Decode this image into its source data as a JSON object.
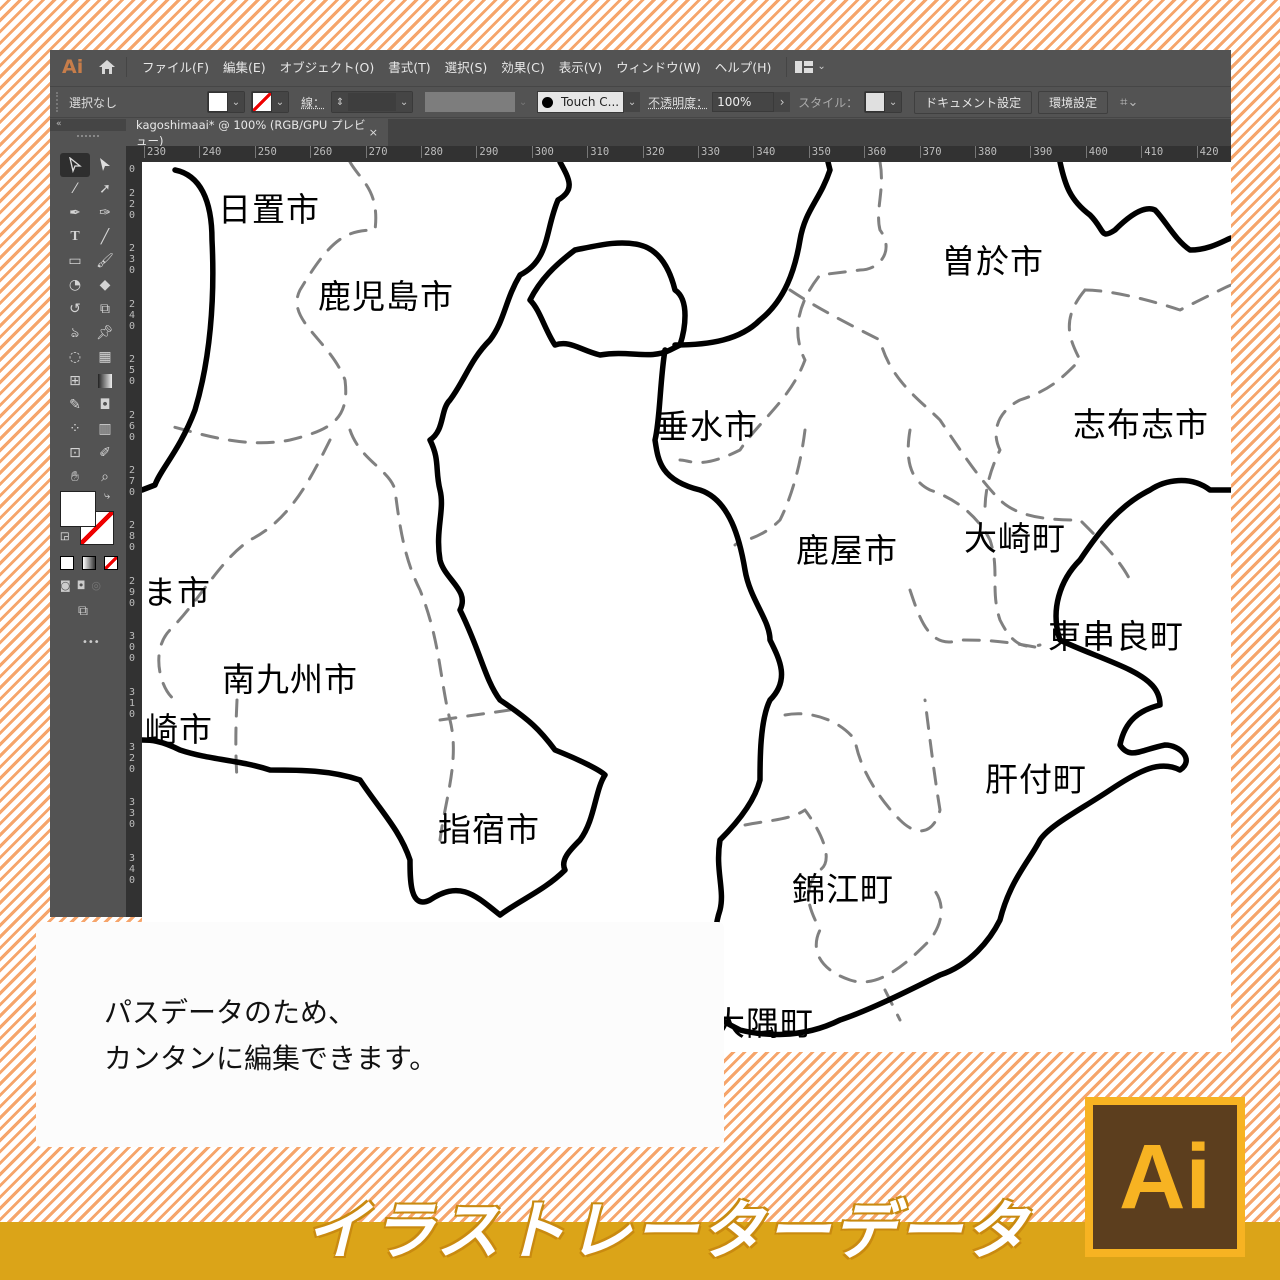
{
  "app": {
    "logo": "Ai",
    "menu": [
      "ファイル(F)",
      "編集(E)",
      "オブジェクト(O)",
      "書式(T)",
      "選択(S)",
      "効果(C)",
      "表示(V)",
      "ウィンドウ(W)",
      "ヘルプ(H)"
    ]
  },
  "control_bar": {
    "selection_status": "選択なし",
    "stroke_label": "線：",
    "brush_name": "Touch C...",
    "opacity_label": "不透明度：",
    "opacity_value": "100%",
    "style_label": "スタイル：",
    "document_setup_button": "ドキュメント設定",
    "preferences_button": "環境設定"
  },
  "document_tab": {
    "title": "kagoshimaai* @ 100% (RGB/GPU プレビュー)",
    "close": "×"
  },
  "rulers": {
    "horizontal": [
      "230",
      "240",
      "250",
      "260",
      "270",
      "280",
      "290",
      "300",
      "310",
      "320",
      "330",
      "340",
      "350",
      "360",
      "370",
      "380",
      "390",
      "400",
      "410",
      "420"
    ],
    "vertical": [
      "0",
      "220",
      "230",
      "240",
      "250",
      "260",
      "270",
      "280",
      "290",
      "300",
      "310",
      "320",
      "330",
      "340"
    ]
  },
  "map": {
    "places": [
      {
        "name": "日置市"
      },
      {
        "name": "鹿児島市"
      },
      {
        "name": "垂水市"
      },
      {
        "name": "曽於市"
      },
      {
        "name": "志布志市"
      },
      {
        "name": "大崎町"
      },
      {
        "name": "鹿屋市"
      },
      {
        "name": "東串良町"
      },
      {
        "name": "ま市"
      },
      {
        "name": "南九州市"
      },
      {
        "name": "崎市"
      },
      {
        "name": "肝付町"
      },
      {
        "name": "指宿市"
      },
      {
        "name": "錦江町"
      },
      {
        "name": "大隅町"
      }
    ]
  },
  "callout": {
    "line1": "パスデータのため、",
    "line2": "カンタンに編集できます。"
  },
  "banner": {
    "title": "イラストレーターデータ",
    "badge": "Ai"
  },
  "colors": {
    "banner": "#dba418",
    "stripe": "#f6a56b",
    "ui_dark": "#535353",
    "ai_badge_bg": "#5c3e1e",
    "ai_badge_fg": "#f7b322"
  }
}
